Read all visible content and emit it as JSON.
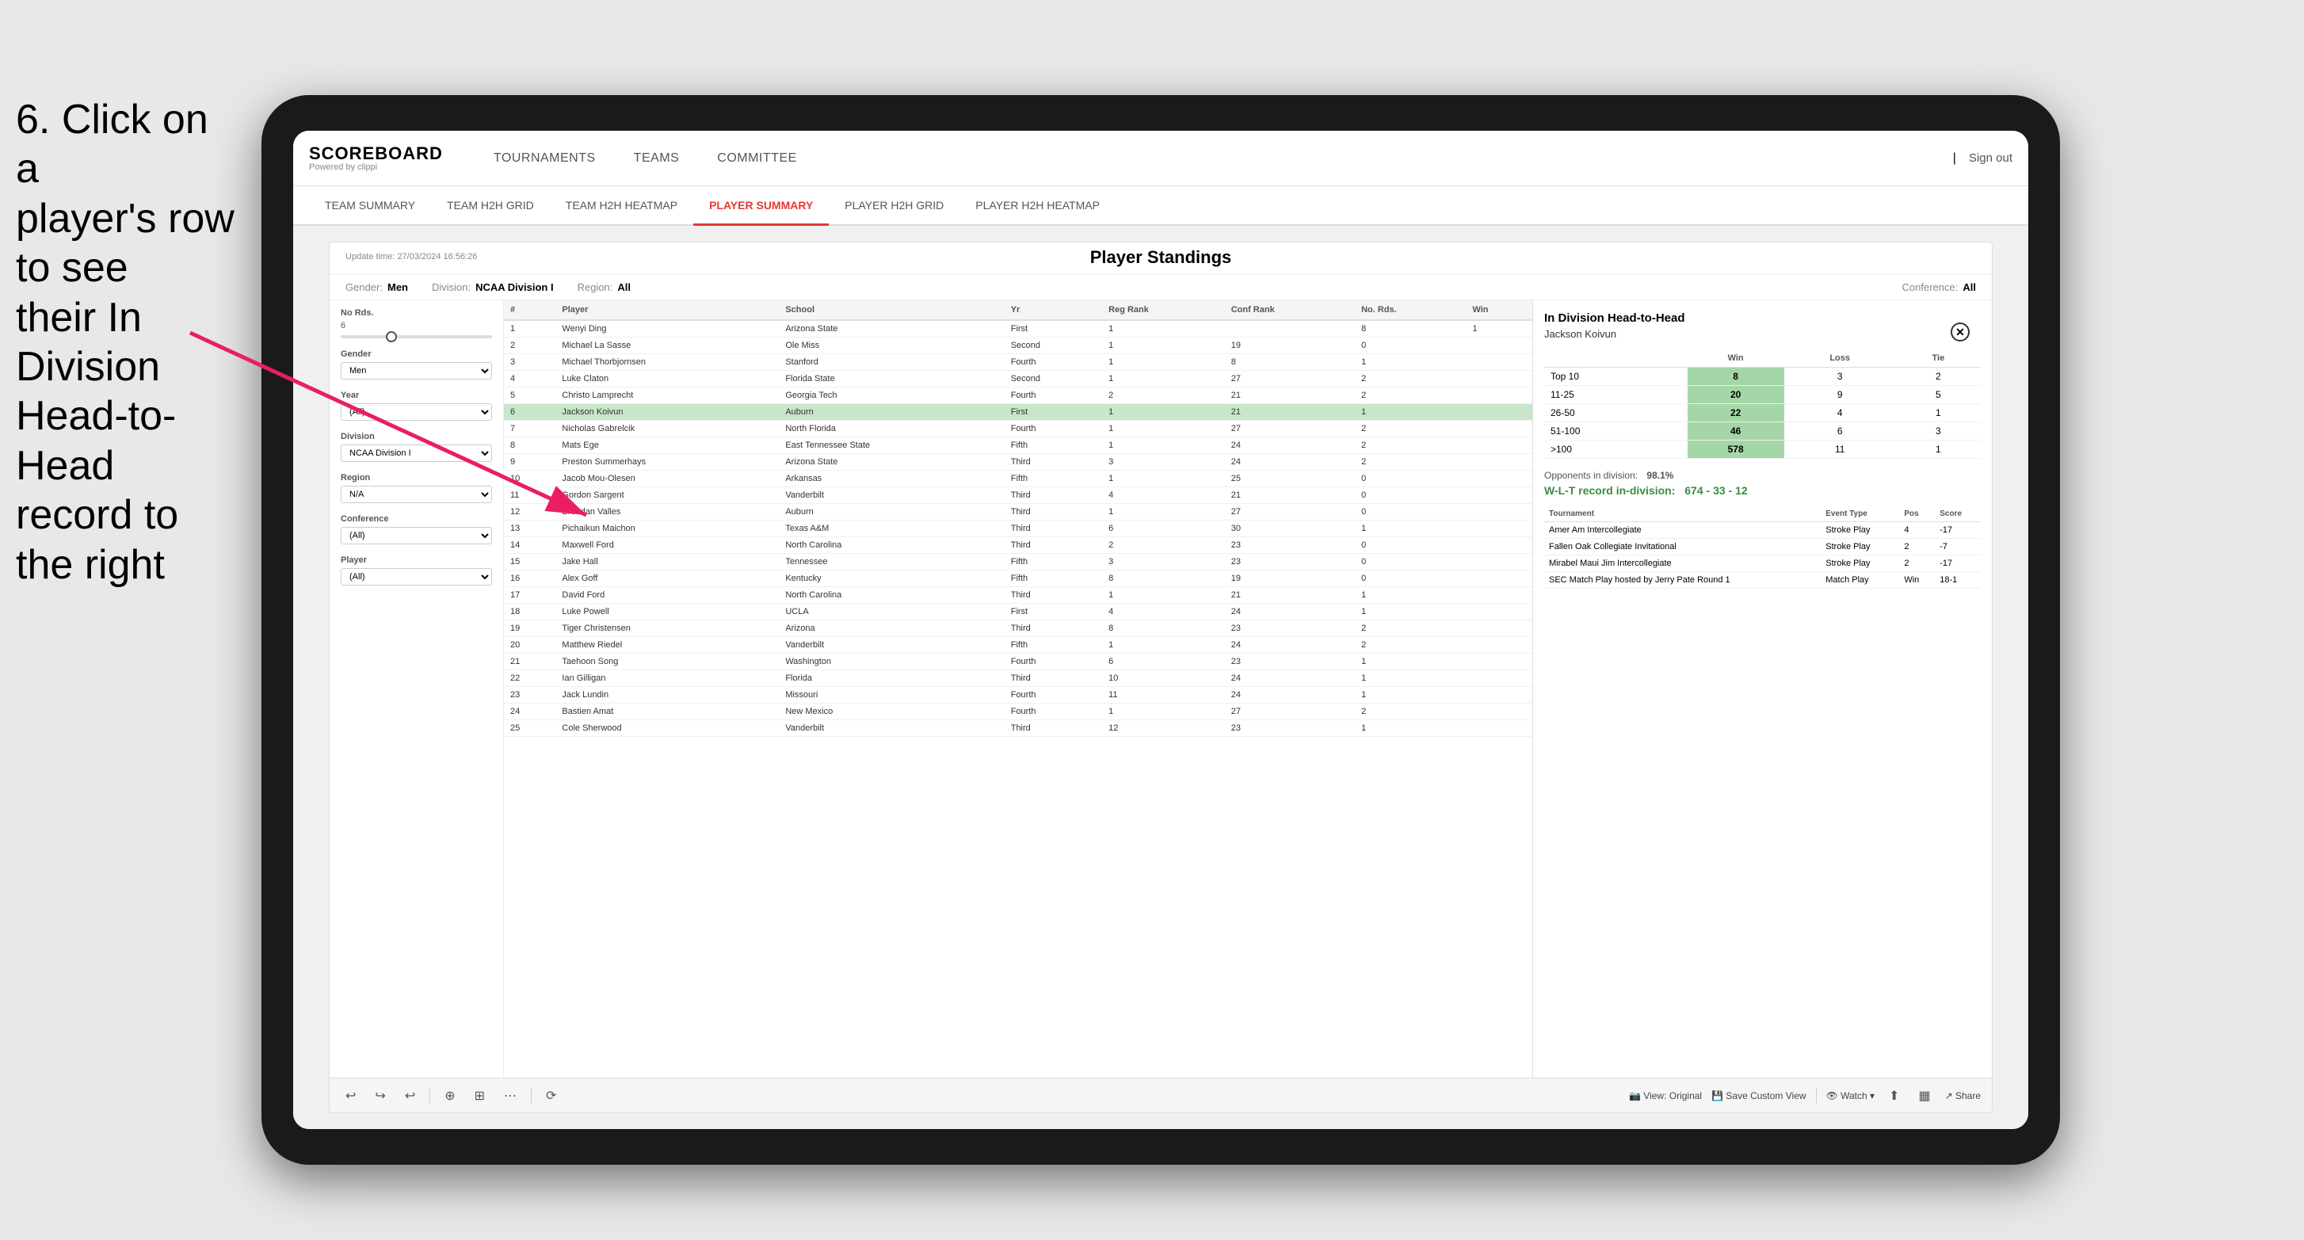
{
  "instruction": {
    "line1": "6. Click on a",
    "line2": "player's row to see",
    "line3": "their In Division",
    "line4": "Head-to-Head",
    "line5": "record to the right"
  },
  "nav": {
    "logo_title": "SCOREBOARD",
    "logo_sub": "Powered by clippi",
    "items": [
      "TOURNAMENTS",
      "TEAMS",
      "COMMITTEE"
    ],
    "sign_out": "Sign out"
  },
  "subnav": {
    "items": [
      "TEAM SUMMARY",
      "TEAM H2H GRID",
      "TEAM H2H HEATMAP",
      "PLAYER SUMMARY",
      "PLAYER H2H GRID",
      "PLAYER H2H HEATMAP"
    ],
    "active": "PLAYER SUMMARY"
  },
  "dashboard": {
    "update_time_label": "Update time:",
    "update_time": "27/03/2024 16:56:26",
    "title": "Player Standings",
    "gender_label": "Gender:",
    "gender_value": "Men",
    "division_label": "Division:",
    "division_value": "NCAA Division I",
    "region_label": "Region:",
    "region_value": "All",
    "conference_label": "Conference:",
    "conference_value": "All"
  },
  "sidebar": {
    "no_rds_label": "No Rds.",
    "no_rds_value": "6",
    "gender_label": "Gender",
    "gender_value": "Men",
    "year_label": "Year",
    "year_value": "(All)",
    "division_label": "Division",
    "division_value": "NCAA Division I",
    "region_label": "Region",
    "region_value": "N/A",
    "conference_label": "Conference",
    "conference_value": "(All)",
    "player_label": "Player",
    "player_value": "(All)"
  },
  "table": {
    "headers": [
      "#",
      "Player",
      "School",
      "Yr",
      "Reg Rank",
      "Conf Rank",
      "No. Rds.",
      "Win"
    ],
    "rows": [
      {
        "num": 1,
        "player": "Wenyi Ding",
        "school": "Arizona State",
        "yr": "First",
        "reg": 1,
        "conf": "",
        "rds": 8,
        "win": 1
      },
      {
        "num": 2,
        "player": "Michael La Sasse",
        "school": "Ole Miss",
        "yr": "Second",
        "reg": 1,
        "conf": 19,
        "rds": 0
      },
      {
        "num": 3,
        "player": "Michael Thorbjornsen",
        "school": "Stanford",
        "yr": "Fourth",
        "reg": 1,
        "conf": 8,
        "rds": 1
      },
      {
        "num": 4,
        "player": "Luke Claton",
        "school": "Florida State",
        "yr": "Second",
        "reg": 1,
        "conf": 27,
        "rds": 2
      },
      {
        "num": 5,
        "player": "Christo Lamprecht",
        "school": "Georgia Tech",
        "yr": "Fourth",
        "reg": 2,
        "conf": 21,
        "rds": 2
      },
      {
        "num": 6,
        "player": "Jackson Koivun",
        "school": "Auburn",
        "yr": "First",
        "reg": 1,
        "conf": 21,
        "rds": 1,
        "selected": true
      },
      {
        "num": 7,
        "player": "Nicholas Gabrelcik",
        "school": "North Florida",
        "yr": "Fourth",
        "reg": 1,
        "conf": 27,
        "rds": 2
      },
      {
        "num": 8,
        "player": "Mats Ege",
        "school": "East Tennessee State",
        "yr": "Fifth",
        "reg": 1,
        "conf": 24,
        "rds": 2
      },
      {
        "num": 9,
        "player": "Preston Summerhays",
        "school": "Arizona State",
        "yr": "Third",
        "reg": 3,
        "conf": 24,
        "rds": 2
      },
      {
        "num": 10,
        "player": "Jacob Mou-Olesen",
        "school": "Arkansas",
        "yr": "Fifth",
        "reg": 1,
        "conf": 25,
        "rds": 0
      },
      {
        "num": 11,
        "player": "Gordon Sargent",
        "school": "Vanderbilt",
        "yr": "Third",
        "reg": 4,
        "conf": 21,
        "rds": 0
      },
      {
        "num": 12,
        "player": "Brendan Valles",
        "school": "Auburn",
        "yr": "Third",
        "reg": 1,
        "conf": 27,
        "rds": 0
      },
      {
        "num": 13,
        "player": "Pichaikun Maichon",
        "school": "Texas A&M",
        "yr": "Third",
        "reg": 6,
        "conf": 30,
        "rds": 1
      },
      {
        "num": 14,
        "player": "Maxwell Ford",
        "school": "North Carolina",
        "yr": "Third",
        "reg": 2,
        "conf": 23,
        "rds": 0
      },
      {
        "num": 15,
        "player": "Jake Hall",
        "school": "Tennessee",
        "yr": "Fifth",
        "reg": 3,
        "conf": 23,
        "rds": 0
      },
      {
        "num": 16,
        "player": "Alex Goff",
        "school": "Kentucky",
        "yr": "Fifth",
        "reg": 8,
        "conf": 19,
        "rds": 0
      },
      {
        "num": 17,
        "player": "David Ford",
        "school": "North Carolina",
        "yr": "Third",
        "reg": 1,
        "conf": 21,
        "rds": 1
      },
      {
        "num": 18,
        "player": "Luke Powell",
        "school": "UCLA",
        "yr": "First",
        "reg": 4,
        "conf": 24,
        "rds": 1
      },
      {
        "num": 19,
        "player": "Tiger Christensen",
        "school": "Arizona",
        "yr": "Third",
        "reg": 8,
        "conf": 23,
        "rds": 2
      },
      {
        "num": 20,
        "player": "Matthew Riedel",
        "school": "Vanderbilt",
        "yr": "Fifth",
        "reg": 1,
        "conf": 24,
        "rds": 2
      },
      {
        "num": 21,
        "player": "Taehoon Song",
        "school": "Washington",
        "yr": "Fourth",
        "reg": 6,
        "conf": 23,
        "rds": 1
      },
      {
        "num": 22,
        "player": "Ian Gilligan",
        "school": "Florida",
        "yr": "Third",
        "reg": 10,
        "conf": 24,
        "rds": 1
      },
      {
        "num": 23,
        "player": "Jack Lundin",
        "school": "Missouri",
        "yr": "Fourth",
        "reg": 11,
        "conf": 24,
        "rds": 1
      },
      {
        "num": 24,
        "player": "Bastien Amat",
        "school": "New Mexico",
        "yr": "Fourth",
        "reg": 1,
        "conf": 27,
        "rds": 2
      },
      {
        "num": 25,
        "player": "Cole Sherwood",
        "school": "Vanderbilt",
        "yr": "Third",
        "reg": 12,
        "conf": 23,
        "rds": 1
      }
    ]
  },
  "h2h": {
    "title": "In Division Head-to-Head",
    "player": "Jackson Koivun",
    "table_headers": [
      "",
      "Win",
      "Loss",
      "Tie"
    ],
    "rows": [
      {
        "range": "Top 10",
        "win": 8,
        "loss": 3,
        "tie": 2
      },
      {
        "range": "11-25",
        "win": 20,
        "loss": 9,
        "tie": 5
      },
      {
        "range": "26-50",
        "win": 22,
        "loss": 4,
        "tie": 1
      },
      {
        "range": "51-100",
        "win": 46,
        "loss": 6,
        "tie": 3
      },
      {
        "range": ">100",
        "win": 578,
        "loss": 11,
        "tie": 1
      }
    ],
    "opponents_label": "Opponents in division:",
    "opponents_pct": "98.1%",
    "record_label": "W-L-T record in-division:",
    "record": "674 - 33 - 12",
    "tournament_headers": [
      "Tournament",
      "Event Type",
      "Pos",
      "Score"
    ],
    "tournaments": [
      {
        "name": "Amer Am Intercollegiate",
        "type": "Stroke Play",
        "pos": 4,
        "score": "-17"
      },
      {
        "name": "Fallen Oak Collegiate Invitational",
        "type": "Stroke Play",
        "pos": 2,
        "score": "-7"
      },
      {
        "name": "Mirabel Maui Jim Intercollegiate",
        "type": "Stroke Play",
        "pos": 2,
        "score": "-17"
      },
      {
        "name": "SEC Match Play hosted by Jerry Pate Round 1",
        "type": "Match Play",
        "pos": "Win",
        "score": "18-1"
      }
    ]
  },
  "toolbar": {
    "undo": "↩",
    "redo": "↪",
    "more_undo": "↩",
    "refresh": "⟳",
    "view_original": "View: Original",
    "save_custom": "Save Custom View",
    "watch": "Watch ▾",
    "share": "Share"
  }
}
